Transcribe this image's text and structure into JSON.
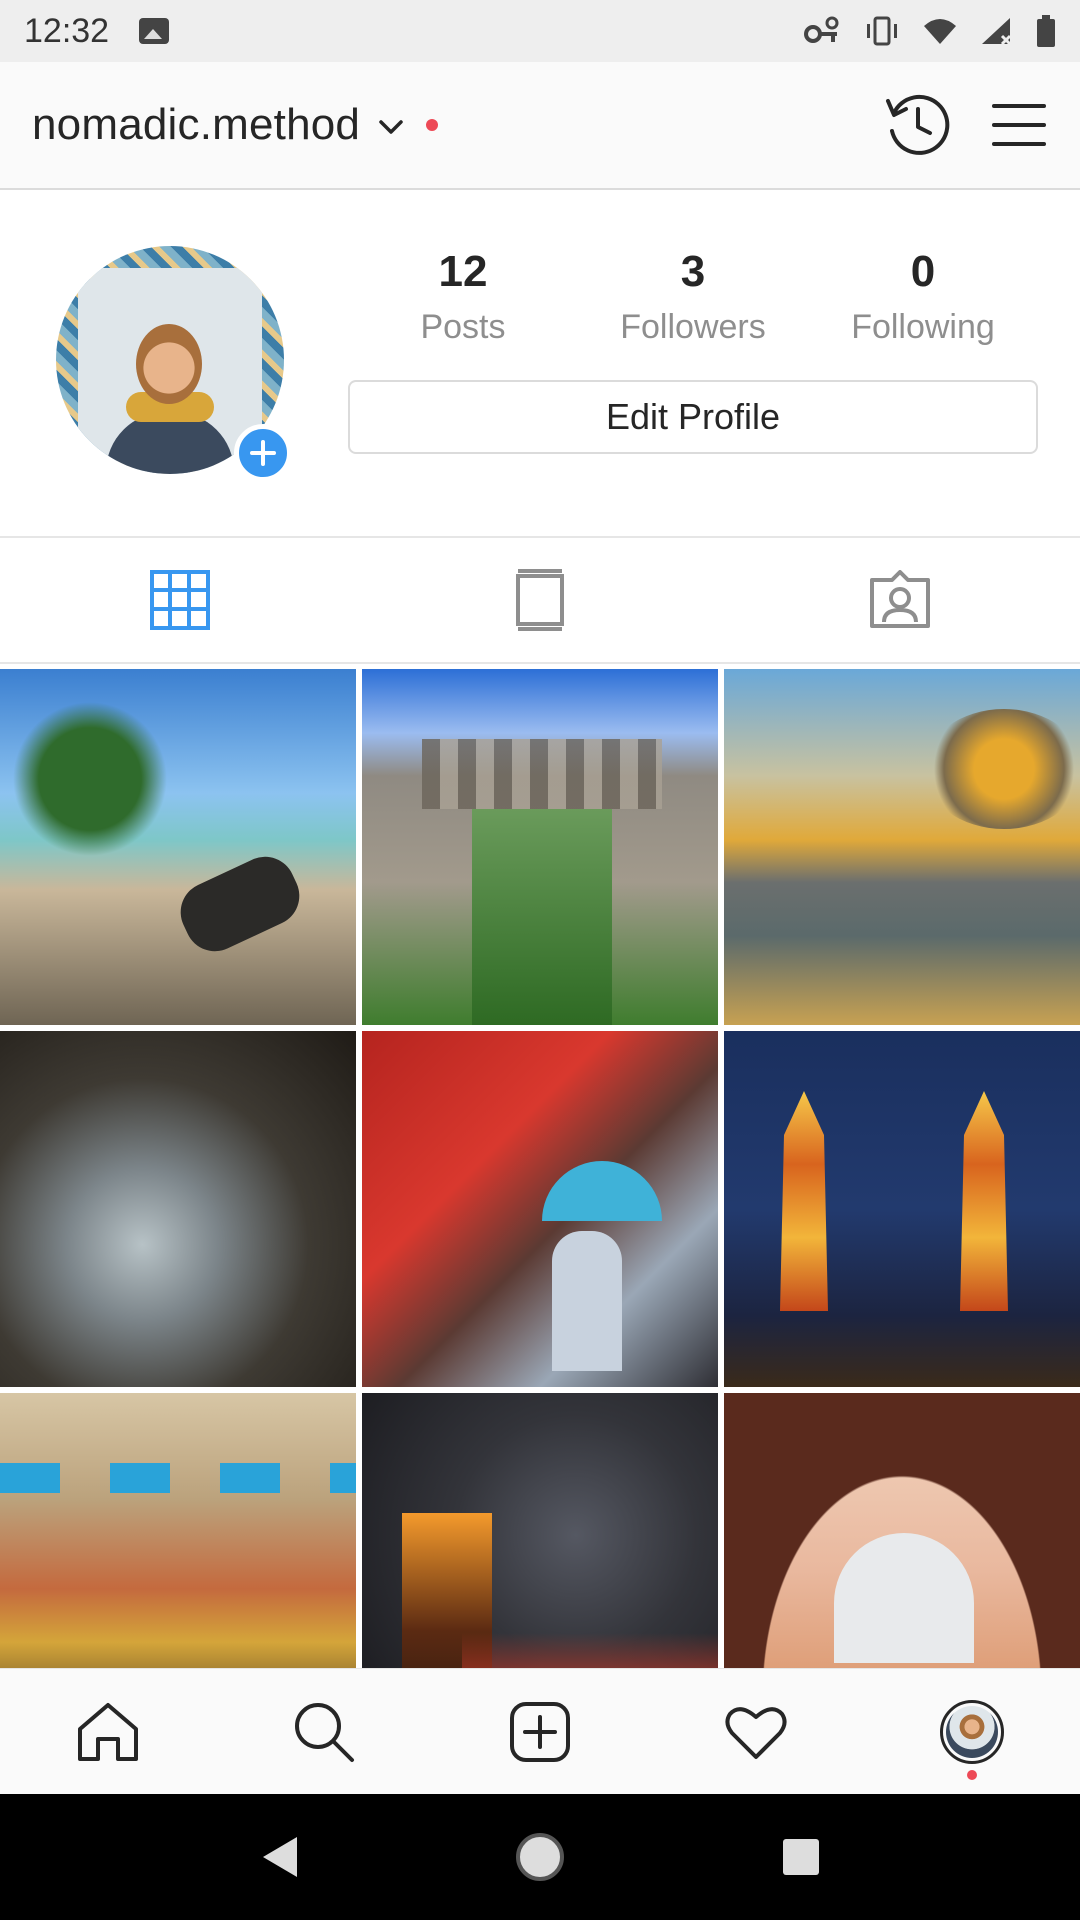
{
  "status_bar": {
    "time": "12:32",
    "icons": [
      "image-icon",
      "vpn-key-icon",
      "vibrate-icon",
      "wifi-icon",
      "signal-icon",
      "battery-icon"
    ]
  },
  "header": {
    "username": "nomadic.method",
    "icons": [
      "chevron-down-icon",
      "archive-history-icon",
      "menu-icon"
    ],
    "notification_dot_color": "#ed4956"
  },
  "profile": {
    "stats": [
      {
        "value": "12",
        "label": "Posts"
      },
      {
        "value": "3",
        "label": "Followers"
      },
      {
        "value": "0",
        "label": "Following"
      }
    ],
    "edit_button": "Edit Profile",
    "add_story_color": "#3897f0"
  },
  "tabs": [
    {
      "icon": "grid-icon",
      "active": true
    },
    {
      "icon": "igtv-icon",
      "active": false
    },
    {
      "icon": "tagged-icon",
      "active": false
    }
  ],
  "posts": [
    {
      "subject": "beach-cannon"
    },
    {
      "subject": "courtyard-ruins"
    },
    {
      "subject": "sunset-beach"
    },
    {
      "subject": "waterfall-cave"
    },
    {
      "subject": "red-market-street"
    },
    {
      "subject": "twin-pagodas"
    },
    {
      "subject": "ghat-ceremony"
    },
    {
      "subject": "night-aarti"
    },
    {
      "subject": "taj-mahal-arch"
    }
  ],
  "bottom_nav": [
    "home-icon",
    "search-icon",
    "new-post-icon",
    "activity-heart-icon",
    "profile-avatar"
  ],
  "colors": {
    "accent": "#3897f0",
    "text": "#262626",
    "muted": "#8e8e8e",
    "border": "#dbdbdb"
  }
}
